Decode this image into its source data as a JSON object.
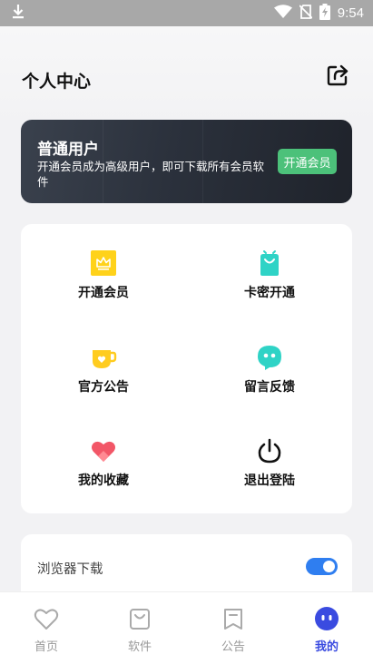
{
  "status_bar": {
    "time": "9:54",
    "icons": [
      "download-icon",
      "wifi-icon",
      "no-sim-icon",
      "battery-charging-icon"
    ]
  },
  "header": {
    "title": "个人中心",
    "share_icon": "share-icon"
  },
  "member": {
    "title": "普通用户",
    "description": "开通会员成为高级用户，即可下载所有会员软件",
    "button_label": "开通会员",
    "button_color": "#4cc17a"
  },
  "menu": {
    "items": [
      {
        "label": "开通会员",
        "icon": "crown-icon",
        "color": "#ffd21a"
      },
      {
        "label": "卡密开通",
        "icon": "shopping-bag-icon",
        "color": "#2fd3c6"
      },
      {
        "label": "官方公告",
        "icon": "cup-icon",
        "color": "#ffcc1f"
      },
      {
        "label": "留言反馈",
        "icon": "chat-bubble-icon",
        "color": "#2fd3c6"
      },
      {
        "label": "我的收藏",
        "icon": "heart-icon",
        "color": "#f25667"
      },
      {
        "label": "退出登陆",
        "icon": "power-icon",
        "color": "#111111"
      }
    ]
  },
  "settings": {
    "browser_download_label": "浏览器下载",
    "browser_download_enabled": true,
    "toggle_color": "#2f7ef0"
  },
  "nav": {
    "items": [
      {
        "label": "首页",
        "icon": "heart-outline-icon",
        "active": false
      },
      {
        "label": "软件",
        "icon": "bag-outline-icon",
        "active": false
      },
      {
        "label": "公告",
        "icon": "bookmark-outline-icon",
        "active": false
      },
      {
        "label": "我的",
        "icon": "profile-face-icon",
        "active": true
      }
    ],
    "active_color": "#3a4be0"
  }
}
